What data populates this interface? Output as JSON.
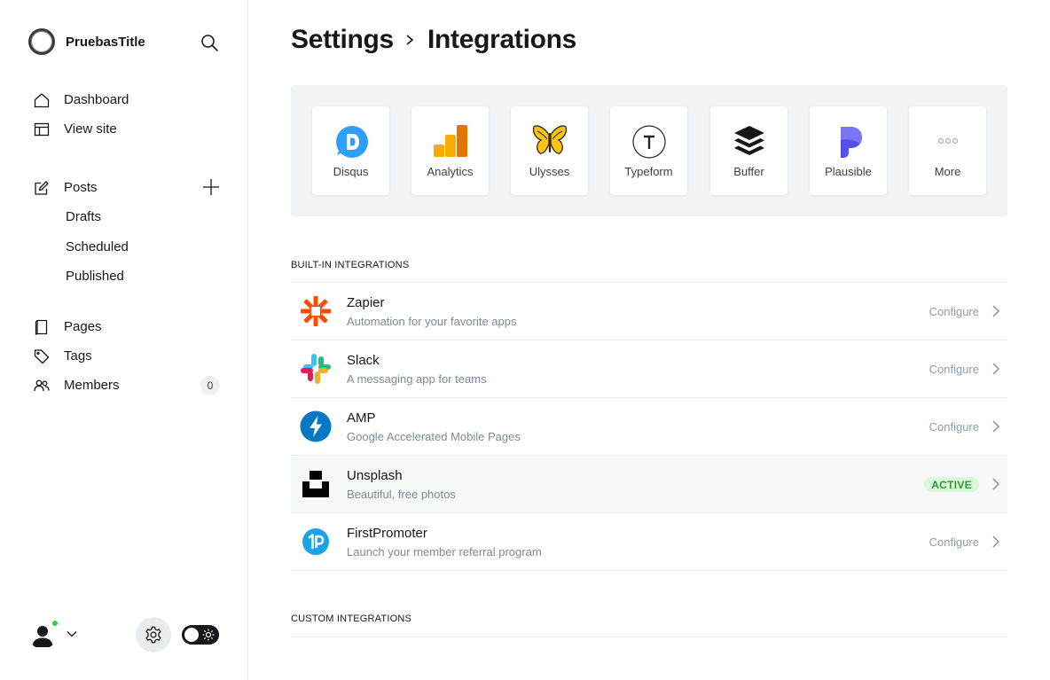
{
  "sidebar": {
    "brand": "PruebasTitle",
    "nav_primary": [
      {
        "label": "Dashboard",
        "icon": "home-icon"
      },
      {
        "label": "View site",
        "icon": "layout-icon"
      }
    ],
    "posts": {
      "label": "Posts",
      "icon": "edit-icon",
      "sub": [
        "Drafts",
        "Scheduled",
        "Published"
      ]
    },
    "nav_secondary": [
      {
        "label": "Pages",
        "icon": "page-icon"
      },
      {
        "label": "Tags",
        "icon": "tag-icon"
      },
      {
        "label": "Members",
        "icon": "members-icon",
        "count": "0"
      }
    ]
  },
  "header": {
    "crumb_parent": "Settings",
    "crumb_current": "Integrations"
  },
  "apps": [
    {
      "label": "Disqus",
      "icon": "disqus-icon",
      "color": "#2e9fff"
    },
    {
      "label": "Analytics",
      "icon": "google-analytics-icon",
      "color": "#f9ab00"
    },
    {
      "label": "Ulysses",
      "icon": "butterfly-icon",
      "color": "#f5c518"
    },
    {
      "label": "Typeform",
      "icon": "typeform-icon",
      "color": "#262627"
    },
    {
      "label": "Buffer",
      "icon": "buffer-icon",
      "color": "#15171a"
    },
    {
      "label": "Plausible",
      "icon": "plausible-icon",
      "color": "#5850ec"
    },
    {
      "label": "More",
      "icon": "more-icon",
      "color": "#9aa5b1"
    }
  ],
  "builtin": {
    "heading": "BUILT-IN INTEGRATIONS",
    "items": [
      {
        "name": "Zapier",
        "desc": "Automation for your favorite apps",
        "action": "Configure",
        "icon": "zapier-icon",
        "color": "#ff4a00"
      },
      {
        "name": "Slack",
        "desc": "A messaging app for teams",
        "action": "Configure",
        "icon": "slack-icon",
        "color": "#e01e5a"
      },
      {
        "name": "AMP",
        "desc": "Google Accelerated Mobile Pages",
        "action": "Configure",
        "icon": "amp-icon",
        "color": "#0379c4"
      },
      {
        "name": "Unsplash",
        "desc": "Beautiful, free photos",
        "action": "ACTIVE",
        "icon": "unsplash-icon",
        "color": "#000000"
      },
      {
        "name": "FirstPromoter",
        "desc": "Launch your member referral program",
        "action": "Configure",
        "icon": "firstpromoter-icon",
        "color": "#1aa3e9"
      }
    ]
  },
  "custom": {
    "heading": "CUSTOM INTEGRATIONS"
  }
}
